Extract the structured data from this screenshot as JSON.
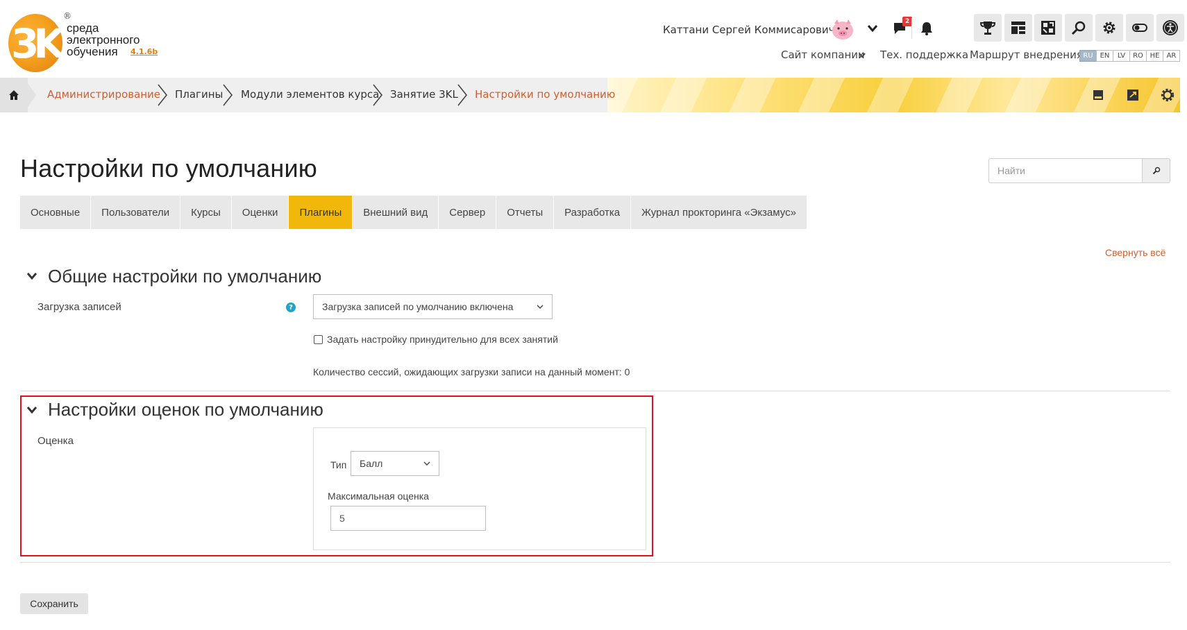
{
  "header": {
    "logo": {
      "mark": "3K",
      "line1": "среда",
      "line2": "электронного",
      "line3": "обучения",
      "version": "4.1.6b",
      "reg": "®"
    },
    "user_name": "Каттани Сергей Коммисарович",
    "messages_count": "2",
    "links": {
      "company_site": "Сайт компании",
      "support": "Тех. поддержка",
      "route": "Маршрут внедрения"
    },
    "languages": [
      "RU",
      "EN",
      "LV",
      "RO",
      "HE",
      "AR"
    ],
    "active_language": "RU"
  },
  "breadcrumb": {
    "items": [
      {
        "label": "Администрирование"
      },
      {
        "label": "Плагины"
      },
      {
        "label": "Модули элементов курса"
      },
      {
        "label": "Занятие 3KL"
      },
      {
        "label": "Настройки по умолчанию"
      }
    ]
  },
  "page": {
    "title": "Настройки по умолчанию",
    "search_placeholder": "Найти",
    "collapse_all": "Свернуть всё"
  },
  "tabs": [
    {
      "label": "Основные"
    },
    {
      "label": "Пользователи"
    },
    {
      "label": "Курсы"
    },
    {
      "label": "Оценки"
    },
    {
      "label": "Плагины"
    },
    {
      "label": "Внешний вид"
    },
    {
      "label": "Сервер"
    },
    {
      "label": "Отчеты"
    },
    {
      "label": "Разработка"
    },
    {
      "label": "Журнал прокторинга «Экзамус»"
    }
  ],
  "active_tab": "Плагины",
  "section_general": {
    "title": "Общие настройки по умолчанию",
    "recording_label": "Загрузка записей",
    "recording_value": "Загрузка записей по умолчанию включена",
    "force_label": "Задать настройку принудительно для всех занятий",
    "sessions_text": "Количество сессий, ожидающих загрузки записи на данный момент: 0"
  },
  "section_grades": {
    "title": "Настройки оценок по умолчанию",
    "grade_label": "Оценка",
    "type_label": "Тип",
    "type_value": "Балл",
    "max_label": "Максимальная оценка",
    "max_value": "5"
  },
  "buttons": {
    "save": "Сохранить"
  },
  "colors": {
    "accent": "#f1b80b",
    "link": "#d35d2c",
    "highlight": "#e0111a"
  }
}
